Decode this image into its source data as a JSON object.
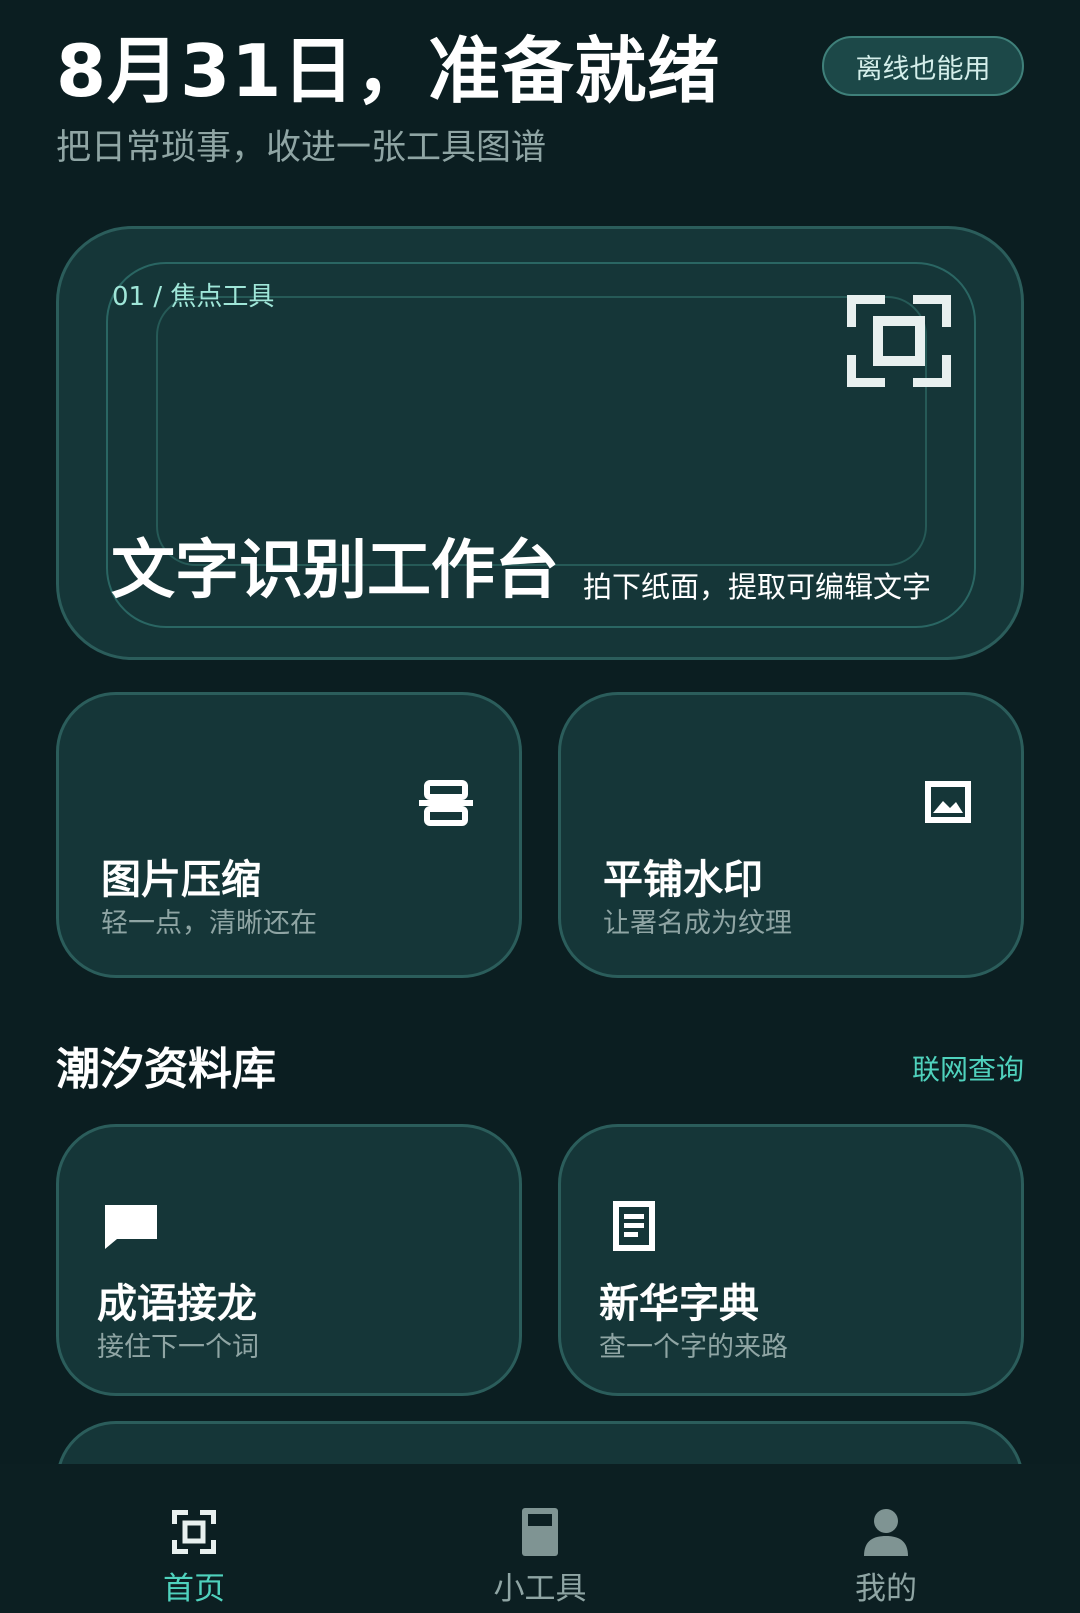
{
  "header": {
    "title": "8月31日，准备就绪",
    "subtitle": "把日常琐事，收进一张工具图谱",
    "badge": "离线也能用"
  },
  "hero": {
    "eyebrow": "01 / 焦点工具",
    "title": "文字识别工作台",
    "description": "拍下纸面，提取可编辑文字",
    "icon": "scan-frame-icon"
  },
  "tools": [
    {
      "title": "图片压缩",
      "subtitle": "轻一点，清晰还在",
      "icon": "compress-icon"
    },
    {
      "title": "平铺水印",
      "subtitle": "让署名成为纹理",
      "icon": "image-icon"
    }
  ],
  "library": {
    "title": "潮汐资料库",
    "link": "联网查询",
    "items": [
      {
        "title": "成语接龙",
        "subtitle": "接住下一个词",
        "icon": "chat-bubble-icon"
      },
      {
        "title": "新华字典",
        "subtitle": "查一个字的来路",
        "icon": "document-icon"
      }
    ]
  },
  "nav": {
    "items": [
      {
        "label": "首页",
        "icon": "scan-frame-icon",
        "active": true
      },
      {
        "label": "小工具",
        "icon": "book-icon",
        "active": false
      },
      {
        "label": "我的",
        "icon": "person-icon",
        "active": false
      }
    ]
  },
  "colors": {
    "background": "#0b1e21",
    "card": "#153638",
    "card_border": "#2b5d5b",
    "accent": "#4fd2bd",
    "muted_text": "#8fa5a4"
  }
}
